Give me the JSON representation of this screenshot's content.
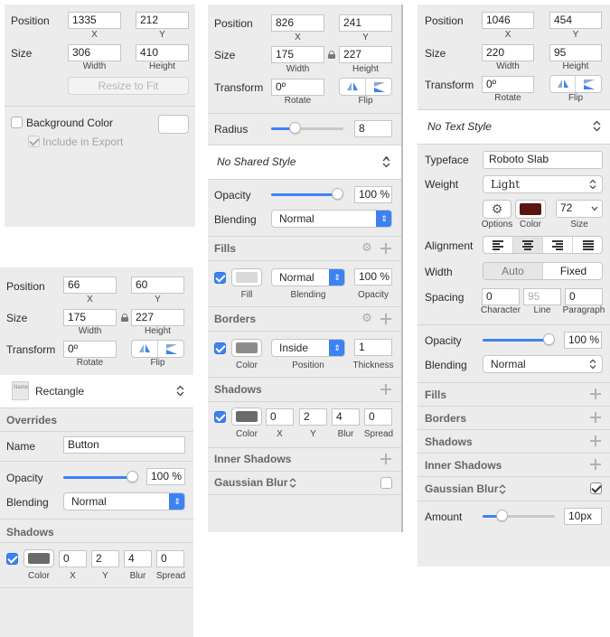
{
  "common": {
    "position_label": "Position",
    "size_label": "Size",
    "transform_label": "Transform",
    "opacity_label": "Opacity",
    "blending_label": "Blending",
    "x_label": "X",
    "y_label": "Y",
    "width_label": "Width",
    "height_label": "Height",
    "rotate_label": "Rotate",
    "flip_label": "Flip",
    "color_label": "Color",
    "blur_label": "Blur",
    "spread_label": "Spread"
  },
  "panel_a": {
    "position": {
      "x": "1335",
      "y": "212"
    },
    "size": {
      "width": "306",
      "height": "410"
    },
    "resize_button": "Resize to Fit",
    "background_color_label": "Background Color",
    "background_color_checked": false,
    "include_export_label": "Include in Export",
    "include_export_checked": true
  },
  "panel_b": {
    "position": {
      "x": "826",
      "y": "241"
    },
    "size": {
      "width": "175",
      "height": "227"
    },
    "transform": {
      "rotate": "0º"
    },
    "radius_label": "Radius",
    "radius_value": "8",
    "radius_level": 0.3,
    "shared_style": "No Shared Style",
    "opacity_value": "100 %",
    "opacity_level": 1.0,
    "blending_value": "Normal",
    "fills": {
      "header": "Fills",
      "checked": true,
      "color": "#d9d9d9",
      "blending": "Normal",
      "opacity": "100 %",
      "fill_label": "Fill",
      "blending_label": "Blending",
      "opacity_label": "Opacity"
    },
    "borders": {
      "header": "Borders",
      "checked": true,
      "color": "#8c8c8c",
      "position": "Inside",
      "thickness": "1",
      "color_label": "Color",
      "position_label": "Position",
      "thickness_label": "Thickness"
    },
    "shadows": {
      "header": "Shadows",
      "checked": true,
      "color": "#6b6b6b",
      "x": "0",
      "y": "2",
      "blur": "4",
      "spread": "0"
    },
    "inner_shadows_header": "Inner Shadows",
    "gaussian_blur_label": "Gaussian Blur",
    "gaussian_blur_checked": false
  },
  "panel_c": {
    "position": {
      "x": "66",
      "y": "60"
    },
    "size": {
      "width": "175",
      "height": "227"
    },
    "transform": {
      "rotate": "0º"
    },
    "symbol_thumb": "Name",
    "symbol_name": "Rectangle",
    "overrides_header": "Overrides",
    "name_label": "Name",
    "name_value": "Button",
    "opacity_value": "100 %",
    "opacity_level": 1.0,
    "blending_value": "Normal",
    "shadows": {
      "header": "Shadows",
      "checked": true,
      "color": "#6b6b6b",
      "x": "0",
      "y": "2",
      "blur": "4",
      "spread": "0"
    }
  },
  "panel_d": {
    "position": {
      "x": "1046",
      "y": "454"
    },
    "size": {
      "width": "220",
      "height": "95"
    },
    "transform": {
      "rotate": "0º"
    },
    "text_style": "No Text Style",
    "typeface_label": "Typeface",
    "typeface_value": "Roboto Slab",
    "weight_label": "Weight",
    "weight_value": "Light",
    "text_color": "#5a1412",
    "font_size": "72",
    "options_label": "Options",
    "color_label": "Color",
    "size_label": "Size",
    "alignment_label": "Alignment",
    "width_label": "Width",
    "width_auto": "Auto",
    "width_fixed": "Fixed",
    "spacing_label": "Spacing",
    "character_value": "0",
    "line_value": "95",
    "paragraph_value": "0",
    "character_label": "Character",
    "line_label": "Line",
    "paragraph_label": "Paragraph",
    "opacity_value": "100 %",
    "opacity_level": 1.0,
    "blending_value": "Normal",
    "fills_header": "Fills",
    "borders_header": "Borders",
    "shadows_header": "Shadows",
    "inner_shadows_header": "Inner Shadows",
    "gaussian_blur_label": "Gaussian Blur",
    "gaussian_blur_checked": true,
    "amount_label": "Amount",
    "amount_value": "10px",
    "amount_level": 0.22
  }
}
